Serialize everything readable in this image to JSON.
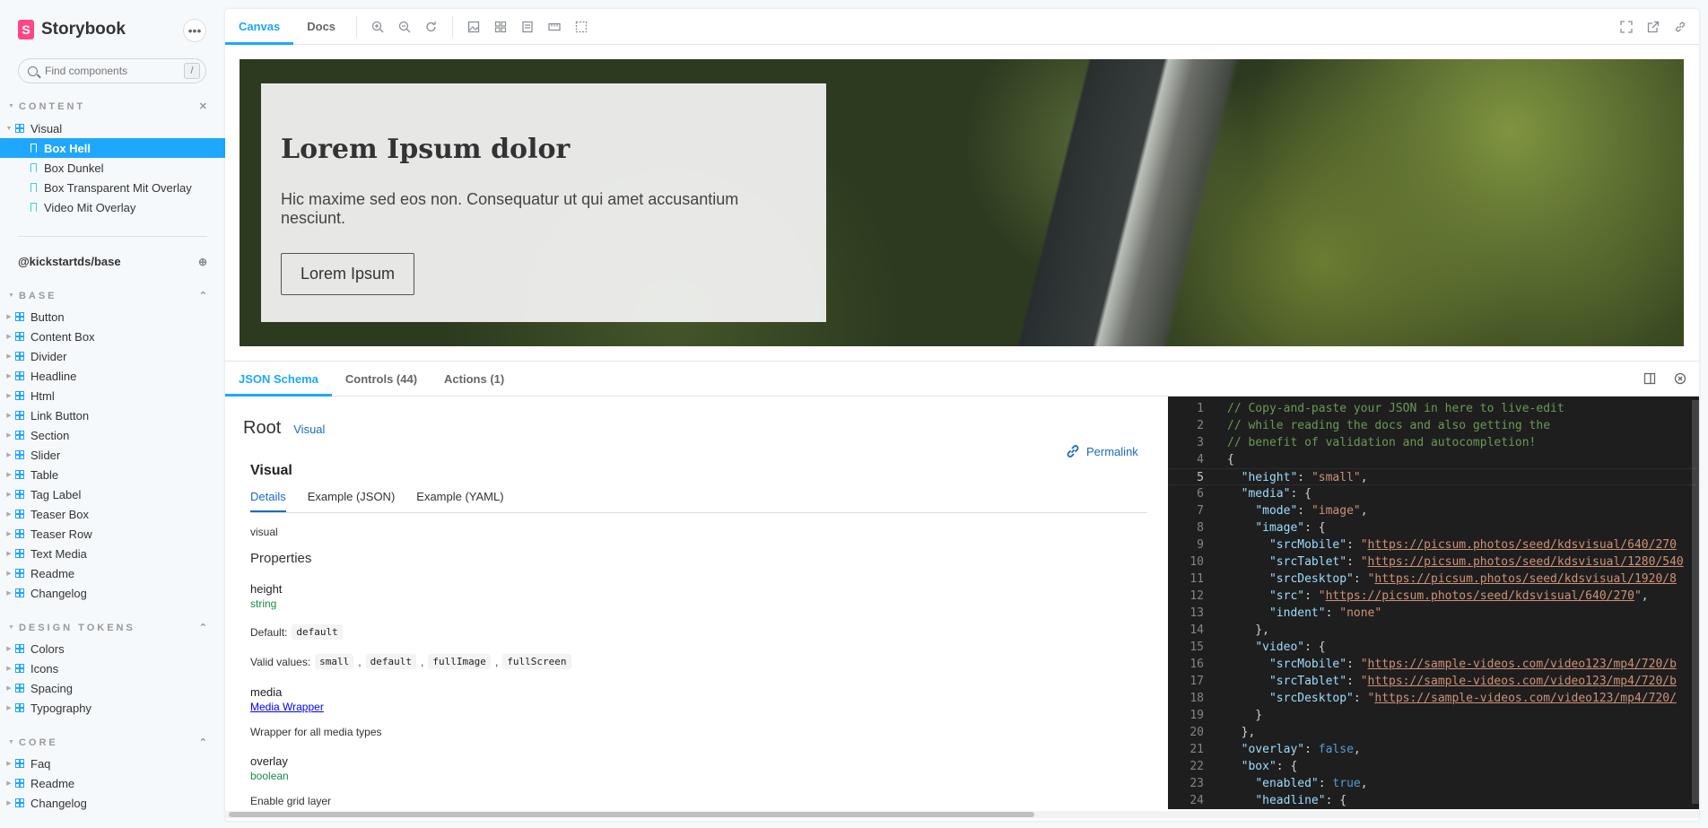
{
  "brand": {
    "name": "Storybook",
    "logo_letter": "S"
  },
  "search": {
    "placeholder": "Find components",
    "shortcut": "/"
  },
  "sidebar": {
    "content_header": "CONTENT",
    "content_group": "Visual",
    "stories": [
      "Box Hell",
      "Box Dunkel",
      "Box Transparent Mit Overlay",
      "Video Mit Overlay"
    ],
    "active_story": "Box Hell",
    "ref_title": "@kickstartds/base",
    "base_header": "BASE",
    "base_items": [
      "Button",
      "Content Box",
      "Divider",
      "Headline",
      "Html",
      "Link Button",
      "Section",
      "Slider",
      "Table",
      "Tag Label",
      "Teaser Box",
      "Teaser Row",
      "Text Media",
      "Readme",
      "Changelog"
    ],
    "tokens_header": "DESIGN TOKENS",
    "tokens_items": [
      "Colors",
      "Icons",
      "Spacing",
      "Typography"
    ],
    "core_header": "CORE",
    "core_items": [
      "Faq",
      "Readme",
      "Changelog"
    ]
  },
  "toolbar": {
    "tabs": [
      "Canvas",
      "Docs"
    ],
    "active_tab": "Canvas"
  },
  "preview": {
    "title": "Lorem Ipsum dolor",
    "text": "Hic maxime sed eos non. Consequatur ut qui amet accusantium nesciunt.",
    "button": "Lorem Ipsum"
  },
  "addons": {
    "tabs": [
      "JSON Schema",
      "Controls (44)",
      "Actions (1)"
    ],
    "active_tab": "JSON Schema"
  },
  "docs": {
    "root_title": "Root",
    "root_link": "Visual",
    "permalink": "Permalink",
    "schema_title": "Visual",
    "subtabs": [
      "Details",
      "Example (JSON)",
      "Example (YAML)"
    ],
    "description": "visual",
    "properties_label": "Properties",
    "height": {
      "name": "height",
      "type": "string",
      "default_label": "Default:",
      "default_value": "default",
      "valid_label": "Valid values:",
      "valid_values": [
        "small",
        "default",
        "fullImage",
        "fullScreen"
      ]
    },
    "media": {
      "name": "media",
      "link": "Media Wrapper",
      "description": "Wrapper for all media types"
    },
    "overlay": {
      "name": "overlay",
      "type": "boolean",
      "description": "Enable grid layer"
    }
  },
  "editor": {
    "current_line": 5,
    "lines": [
      [
        [
          "c-comment",
          "// Copy-and-paste your JSON in here to live-edit"
        ]
      ],
      [
        [
          "c-comment",
          "// while reading the docs and also getting the"
        ]
      ],
      [
        [
          "c-comment",
          "// benefit of validation and autocompletion!"
        ]
      ],
      [
        [
          "",
          "{"
        ]
      ],
      [
        [
          "",
          "  "
        ],
        [
          "c-key",
          "\"height\""
        ],
        [
          "",
          ": "
        ],
        [
          "c-str",
          "\"small\""
        ],
        [
          "",
          ","
        ]
      ],
      [
        [
          "",
          "  "
        ],
        [
          "c-key",
          "\"media\""
        ],
        [
          "",
          ": {"
        ]
      ],
      [
        [
          "",
          "    "
        ],
        [
          "c-key",
          "\"mode\""
        ],
        [
          "",
          ": "
        ],
        [
          "c-str",
          "\"image\""
        ],
        [
          "",
          ","
        ]
      ],
      [
        [
          "",
          "    "
        ],
        [
          "c-key",
          "\"image\""
        ],
        [
          "",
          ": {"
        ]
      ],
      [
        [
          "",
          "      "
        ],
        [
          "c-key",
          "\"srcMobile\""
        ],
        [
          "",
          ": "
        ],
        [
          "c-str",
          "\""
        ],
        [
          "c-url",
          "https://picsum.photos/seed/kdsvisual/640/270"
        ]
      ],
      [
        [
          "",
          "      "
        ],
        [
          "c-key",
          "\"srcTablet\""
        ],
        [
          "",
          ": "
        ],
        [
          "c-str",
          "\""
        ],
        [
          "c-url",
          "https://picsum.photos/seed/kdsvisual/1280/540"
        ]
      ],
      [
        [
          "",
          "      "
        ],
        [
          "c-key",
          "\"srcDesktop\""
        ],
        [
          "",
          ": "
        ],
        [
          "c-str",
          "\""
        ],
        [
          "c-url",
          "https://picsum.photos/seed/kdsvisual/1920/8"
        ]
      ],
      [
        [
          "",
          "      "
        ],
        [
          "c-key",
          "\"src\""
        ],
        [
          "",
          ": "
        ],
        [
          "c-str",
          "\""
        ],
        [
          "c-url",
          "https://picsum.photos/seed/kdsvisual/640/270"
        ],
        [
          "c-str",
          "\""
        ],
        [
          "",
          ","
        ]
      ],
      [
        [
          "",
          "      "
        ],
        [
          "c-key",
          "\"indent\""
        ],
        [
          "",
          ": "
        ],
        [
          "c-str",
          "\"none\""
        ]
      ],
      [
        [
          "",
          "    },"
        ]
      ],
      [
        [
          "",
          "    "
        ],
        [
          "c-key",
          "\"video\""
        ],
        [
          "",
          ": {"
        ]
      ],
      [
        [
          "",
          "      "
        ],
        [
          "c-key",
          "\"srcMobile\""
        ],
        [
          "",
          ": "
        ],
        [
          "c-str",
          "\""
        ],
        [
          "c-url",
          "https://sample-videos.com/video123/mp4/720/b"
        ]
      ],
      [
        [
          "",
          "      "
        ],
        [
          "c-key",
          "\"srcTablet\""
        ],
        [
          "",
          ": "
        ],
        [
          "c-str",
          "\""
        ],
        [
          "c-url",
          "https://sample-videos.com/video123/mp4/720/b"
        ]
      ],
      [
        [
          "",
          "      "
        ],
        [
          "c-key",
          "\"srcDesktop\""
        ],
        [
          "",
          ": "
        ],
        [
          "c-str",
          "\""
        ],
        [
          "c-url",
          "https://sample-videos.com/video123/mp4/720/"
        ]
      ],
      [
        [
          "",
          "    }"
        ]
      ],
      [
        [
          "",
          "  },"
        ]
      ],
      [
        [
          "",
          "  "
        ],
        [
          "c-key",
          "\"overlay\""
        ],
        [
          "",
          ": "
        ],
        [
          "c-kw",
          "false"
        ],
        [
          "",
          ","
        ]
      ],
      [
        [
          "",
          "  "
        ],
        [
          "c-key",
          "\"box\""
        ],
        [
          "",
          ": {"
        ]
      ],
      [
        [
          "",
          "    "
        ],
        [
          "c-key",
          "\"enabled\""
        ],
        [
          "",
          ": "
        ],
        [
          "c-kw",
          "true"
        ],
        [
          "",
          ","
        ]
      ],
      [
        [
          "",
          "    "
        ],
        [
          "c-key",
          "\"headline\""
        ],
        [
          "",
          ": {"
        ]
      ]
    ]
  },
  "colors": {
    "accent": "#1ea7fd",
    "brand": "#ff4785"
  }
}
